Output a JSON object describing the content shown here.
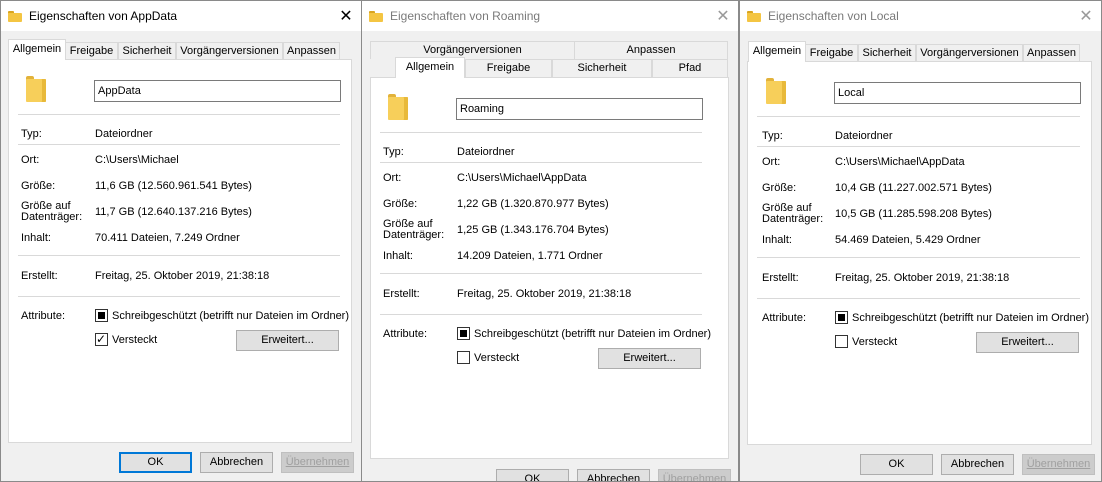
{
  "labels": {
    "typ": "Typ:",
    "ort": "Ort:",
    "groesse": "Größe:",
    "groesse_auf_1": "Größe auf",
    "groesse_auf_2": "Datenträger:",
    "inhalt": "Inhalt:",
    "erstellt": "Erstellt:",
    "attribute": "Attribute:",
    "schreibgeschuetzt": "Schreibgeschützt (betrifft nur Dateien im Ordner)",
    "versteckt": "Versteckt",
    "erweitert": "Erweitert...",
    "ok": "OK",
    "abbrechen": "Abbrechen",
    "uebernehmen": "Übernehmen"
  },
  "tab_labels": {
    "allgemein": "Allgemein",
    "freigabe": "Freigabe",
    "sicherheit": "Sicherheit",
    "vorgaenger": "Vorgängerversionen",
    "anpassen": "Anpassen",
    "pfad": "Pfad"
  },
  "windows": [
    {
      "title": "Eigenschaften von AppData",
      "name": "AppData",
      "typ": "Dateiordner",
      "ort": "C:\\Users\\Michael",
      "groesse": "11,6 GB (12.560.961.541 Bytes)",
      "groesse_auf": "11,7 GB (12.640.137.216 Bytes)",
      "inhalt": "70.411 Dateien, 7.249 Ordner",
      "erstellt": "Freitag, 25. Oktober 2019, 21:38:18",
      "readonly_state": "indeterminate",
      "hidden_state": "checked"
    },
    {
      "title": "Eigenschaften von Roaming",
      "name": "Roaming",
      "typ": "Dateiordner",
      "ort": "C:\\Users\\Michael\\AppData",
      "groesse": "1,22 GB (1.320.870.977 Bytes)",
      "groesse_auf": "1,25 GB (1.343.176.704 Bytes)",
      "inhalt": "14.209 Dateien, 1.771 Ordner",
      "erstellt": "Freitag, 25. Oktober 2019, 21:38:18",
      "readonly_state": "indeterminate",
      "hidden_state": "unchecked"
    },
    {
      "title": "Eigenschaften von Local",
      "name": "Local",
      "typ": "Dateiordner",
      "ort": "C:\\Users\\Michael\\AppData",
      "groesse": "10,4 GB (11.227.002.571 Bytes)",
      "groesse_auf": "10,5 GB (11.285.598.208 Bytes)",
      "inhalt": "54.469 Dateien, 5.429 Ordner",
      "erstellt": "Freitag, 25. Oktober 2019, 21:38:18",
      "readonly_state": "indeterminate",
      "hidden_state": "unchecked"
    }
  ],
  "colors": {
    "accent": "#0078d7",
    "dialog_bg": "#f0f0f0",
    "folder": "#f7cf5a"
  }
}
